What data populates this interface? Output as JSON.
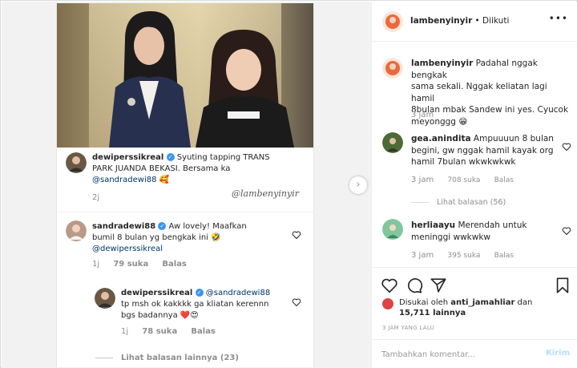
{
  "overlay": {
    "watermark": "@lambenyinyir",
    "comment1": {
      "user": "dewiperssikreal",
      "text_a": " Syuting tapping TRANS",
      "text_b": "PARK JUANDA BEKASI. Bersama ka",
      "mention": "@sandradewi88",
      "emoji": "🥰",
      "time": "2j"
    },
    "comment2": {
      "user": "sandradewi88",
      "text_a": " Aw lovely!  Maafkan",
      "text_b": "bumil 8 bulan yg bengkak ini 🤣",
      "mention": "@dewiperssikreal",
      "time": "1j",
      "likes": "79 suka",
      "reply": "Balas"
    },
    "comment3": {
      "user": "dewiperssikreal",
      "mention": "@sandradewi88",
      "text_a": "tp msh ok kakkkk ga kliatan kerennn",
      "text_b": "bgs badannya ❤️😍",
      "time": "1j",
      "likes": "78 suka",
      "reply": "Balas"
    },
    "view_more": "Lihat balasan lainnya (23)"
  },
  "header": {
    "username": "lambenyinyir",
    "follow_status": "• Diikuti",
    "more_icon": "ellipsis-icon"
  },
  "caption": {
    "username": "lambenyinyir",
    "text_a": " Padahal nggak bengkak",
    "text_b": "sama sekali. Nggak keliatan lagi hamil",
    "text_c": "8bulan mbak Sandew ini yes. Cyucok",
    "text_d": "meyonggg 😁",
    "time": "3 jam"
  },
  "comments": [
    {
      "username": "gea.anindita",
      "text_a": " Ampuuuun 8 bulan",
      "text_b": "begini, gw nggak hamil kayak org",
      "text_c": "hamil 7bulan wkwkwkwk",
      "time": "3 jam",
      "likes": "708 suka",
      "reply": "Balas",
      "view_replies": "Lihat balasan (56)"
    },
    {
      "username": "herliaayu",
      "text_a": " Merendah untuk",
      "text_b": "meninggi wwkwkw",
      "time": "3 jam",
      "likes": "395 suka",
      "reply": "Balas"
    }
  ],
  "actions": {
    "liked_prefix": "Disukai oleh ",
    "liked_user": "anti_jamahliar",
    "liked_and": " dan",
    "liked_count": "15,711 lainnya",
    "post_time": "3 JAM YANG LALU"
  },
  "add_comment": {
    "placeholder": "Tambahkan komentar...",
    "post_label": "Kirim"
  },
  "colors": {
    "verified": "#3897f0",
    "post_button": "#b2dffc",
    "meta_text": "#8e8e8e"
  }
}
